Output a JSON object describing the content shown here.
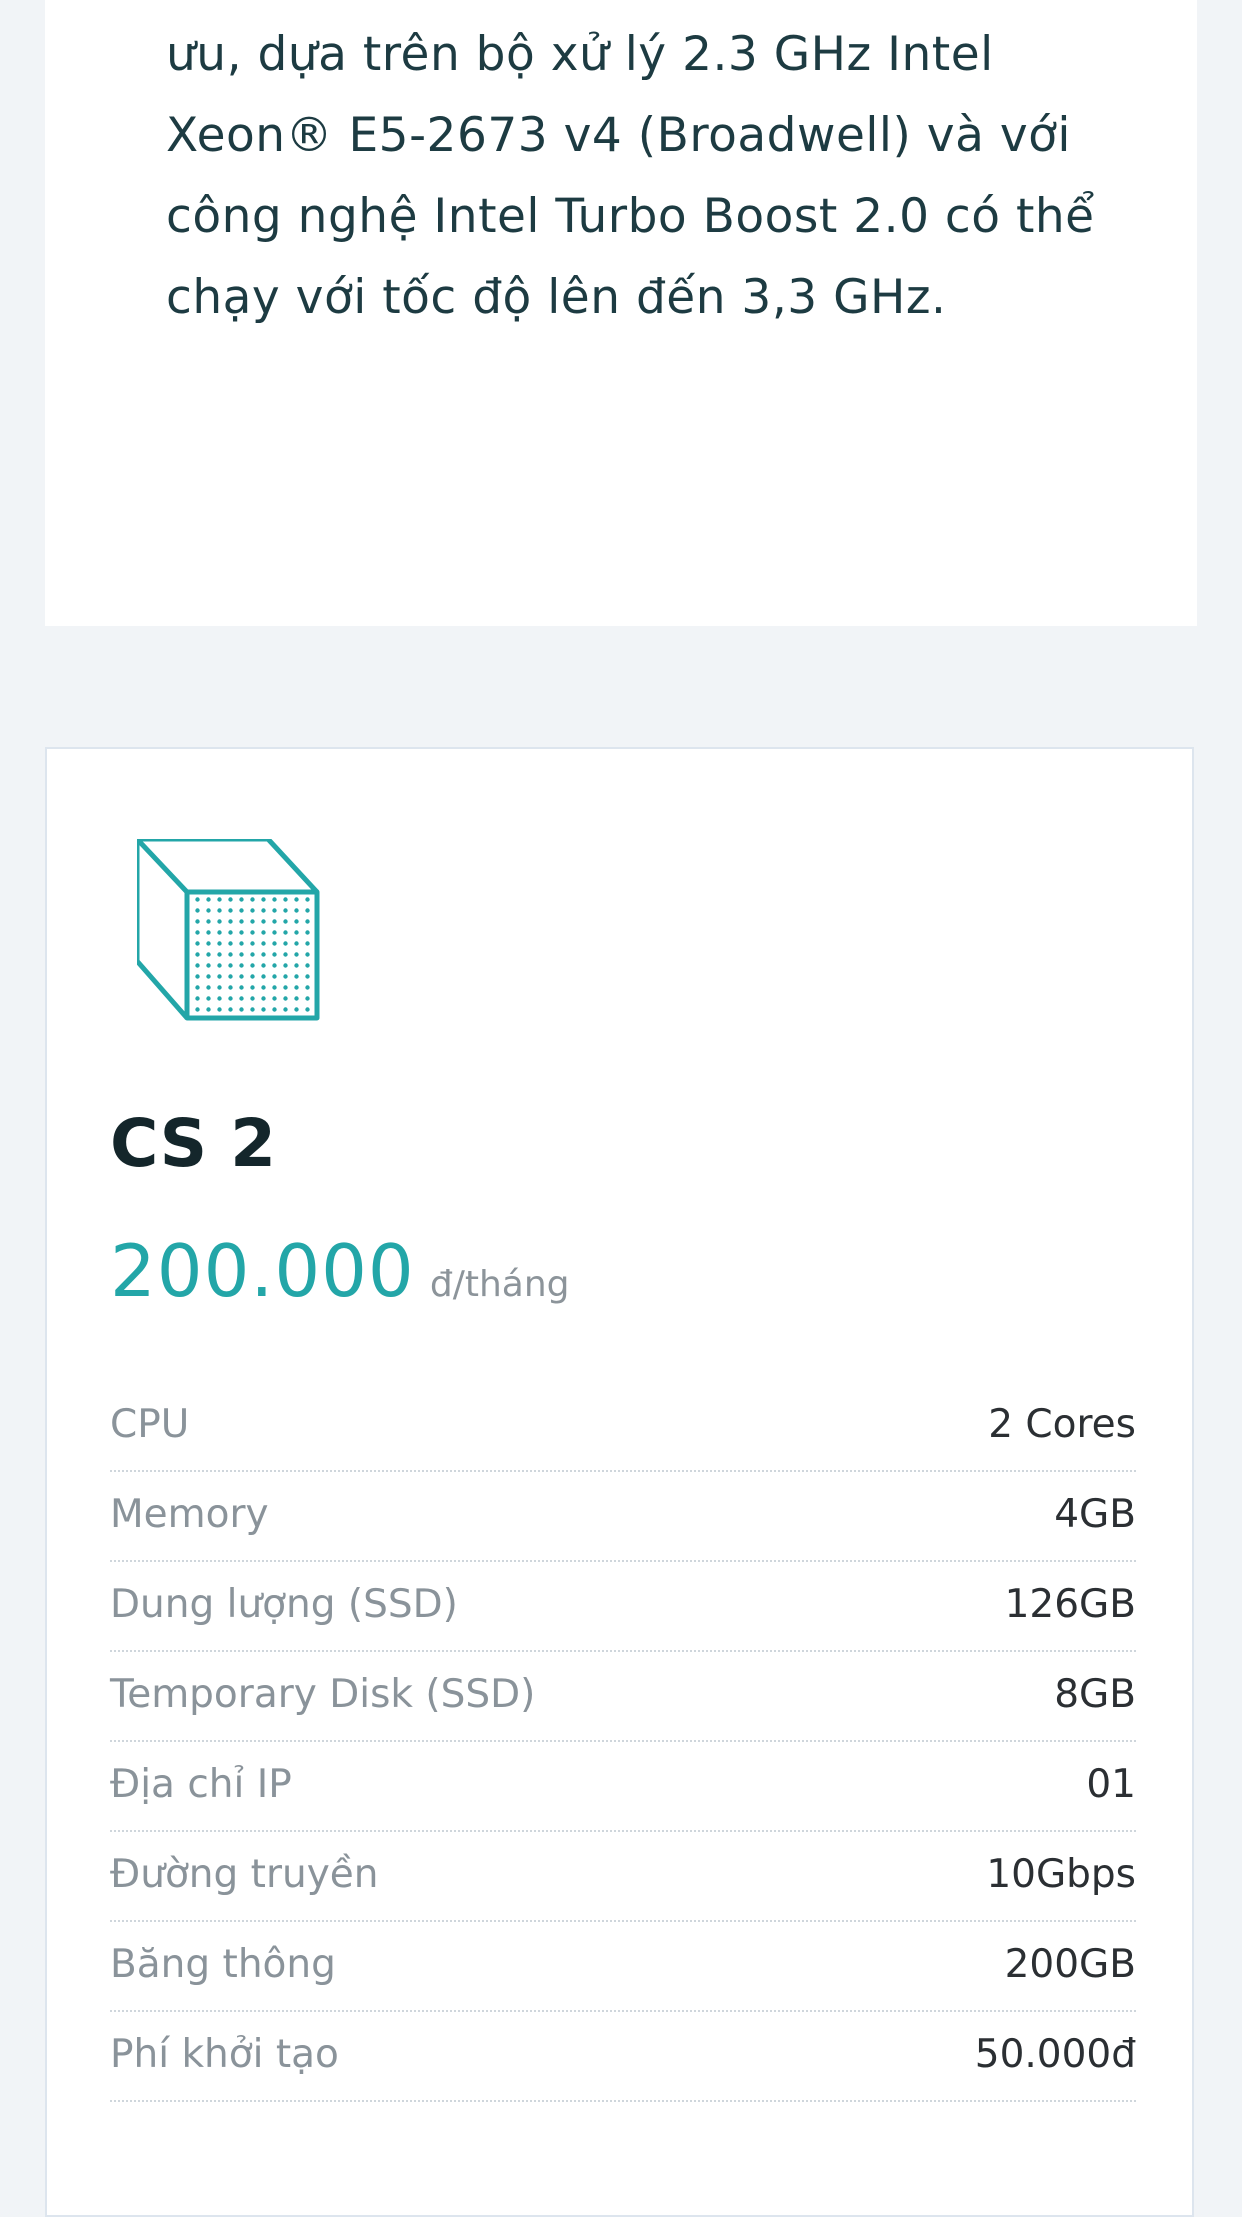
{
  "intro": {
    "text": "ưu, dựa trên bộ xử lý 2.3 GHz Intel Xeon® E5-2673 v4 (Broadwell) và với công nghệ Intel Turbo Boost 2.0 có thể chạy với tốc độ lên đến 3,3 GHz."
  },
  "plan": {
    "icon": "cube-icon",
    "title": "CS 2",
    "price": "200.000",
    "price_unit": "đ/tháng",
    "specs": [
      {
        "label": "CPU",
        "value": "2 Cores"
      },
      {
        "label": "Memory",
        "value": "4GB"
      },
      {
        "label": "Dung lượng (SSD)",
        "value": "126GB"
      },
      {
        "label": "Temporary Disk (SSD)",
        "value": "8GB"
      },
      {
        "label": "Địa chỉ IP",
        "value": "01"
      },
      {
        "label": "Đường truyền",
        "value": "10Gbps"
      },
      {
        "label": "Băng thông",
        "value": "200GB"
      },
      {
        "label": "Phí khởi tạo",
        "value": "50.000đ"
      }
    ]
  },
  "colors": {
    "accent": "#23a6a8",
    "title": "#14262b",
    "label": "#8a939a",
    "background": "#f1f4f7"
  }
}
